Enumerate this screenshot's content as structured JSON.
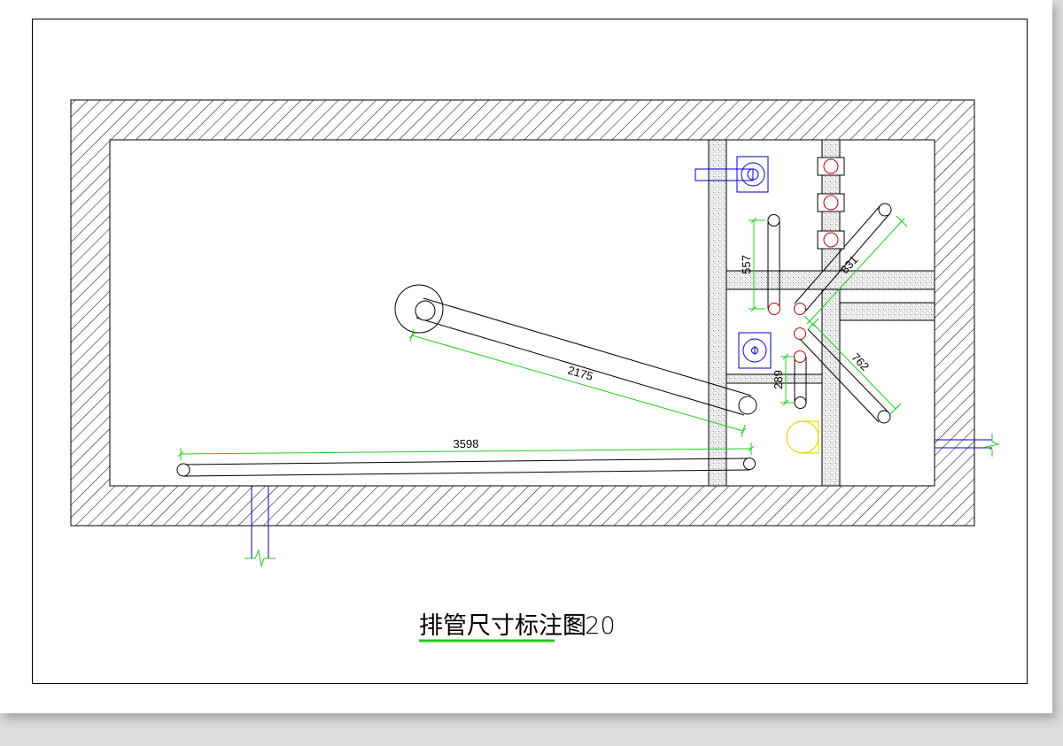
{
  "title": {
    "main": "排管尺寸标注图",
    "scale": "1:20"
  },
  "dimensions": {
    "d3598": "3598",
    "d2175": "2175",
    "d557": "557",
    "d831": "831",
    "d762": "762",
    "d289": "289"
  },
  "colors": {
    "dimension": "#22cc22",
    "pipe": "#000000",
    "fixture": "#0000cc",
    "valve": "#cc0000",
    "drain": "#dddd00",
    "underline": "#22cc22"
  }
}
